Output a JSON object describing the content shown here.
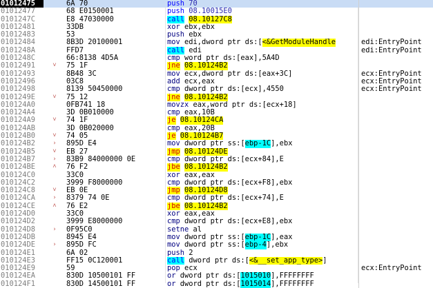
{
  "listing": {
    "rows": [
      {
        "addr": "01012475",
        "arrow": "",
        "bytes": "6A 70",
        "disasm": [
          {
            "t": "push",
            "c": "m-push"
          },
          {
            "t": " 70",
            "c": "op-num"
          }
        ],
        "comment": "",
        "selected": true
      },
      {
        "addr": "01012477",
        "arrow": "",
        "bytes": "68 E0150001",
        "disasm": [
          {
            "t": "push",
            "c": "m-push"
          },
          {
            "t": " 08.10015E0",
            "c": "op-num"
          }
        ],
        "comment": ""
      },
      {
        "addr": "0101247C",
        "arrow": "",
        "bytes": "E8 47030000",
        "disasm": [
          {
            "t": "call",
            "c": "m-call"
          },
          {
            "t": " ",
            "c": "op-plain"
          },
          {
            "t": "08.10127C8",
            "c": "op-sym"
          }
        ],
        "comment": ""
      },
      {
        "addr": "01012481",
        "arrow": "",
        "bytes": "33DB",
        "disasm": [
          {
            "t": "xor",
            "c": "m-plain"
          },
          {
            "t": " ebx,ebx",
            "c": "op-plain"
          }
        ],
        "comment": ""
      },
      {
        "addr": "01012483",
        "arrow": "",
        "bytes": "53",
        "disasm": [
          {
            "t": "push",
            "c": "m-plain"
          },
          {
            "t": " ebx",
            "c": "op-plain"
          }
        ],
        "comment": ""
      },
      {
        "addr": "01012484",
        "arrow": "",
        "bytes": "8B3D 20100001",
        "disasm": [
          {
            "t": "mov",
            "c": "m-plain"
          },
          {
            "t": " edi,dword ptr ds:[",
            "c": "op-plain"
          },
          {
            "t": "<&GetModuleHandle",
            "c": "op-sym"
          },
          {
            "t": "",
            "c": "op-plain"
          }
        ],
        "comment": "edi:EntryPoint"
      },
      {
        "addr": "0101248A",
        "arrow": "",
        "bytes": "FFD7",
        "disasm": [
          {
            "t": "call",
            "c": "m-call"
          },
          {
            "t": " edi",
            "c": "op-plain"
          }
        ],
        "comment": "edi:EntryPoint"
      },
      {
        "addr": "0101248C",
        "arrow": "",
        "bytes": "66:8138 4D5A",
        "disasm": [
          {
            "t": "cmp",
            "c": "m-plain"
          },
          {
            "t": " word ptr ds:[eax],5A4D",
            "c": "op-plain"
          }
        ],
        "comment": ""
      },
      {
        "addr": "01012491",
        "arrow": "v",
        "bytes": "75 1F",
        "disasm": [
          {
            "t": "jne",
            "c": "m-jcc"
          },
          {
            "t": " ",
            "c": "op-plain"
          },
          {
            "t": "08.10124B2",
            "c": "op-sym"
          }
        ],
        "comment": ""
      },
      {
        "addr": "01012493",
        "arrow": "",
        "bytes": "8B48 3C",
        "disasm": [
          {
            "t": "mov",
            "c": "m-plain"
          },
          {
            "t": " ecx,dword ptr ds:[eax+3C]",
            "c": "op-plain"
          }
        ],
        "comment": "ecx:EntryPoint"
      },
      {
        "addr": "01012496",
        "arrow": "",
        "bytes": "03C8",
        "disasm": [
          {
            "t": "add",
            "c": "m-plain"
          },
          {
            "t": " ecx,eax",
            "c": "op-plain"
          }
        ],
        "comment": "ecx:EntryPoint"
      },
      {
        "addr": "01012498",
        "arrow": "",
        "bytes": "8139 50450000",
        "disasm": [
          {
            "t": "cmp",
            "c": "m-plain"
          },
          {
            "t": " dword ptr ds:[ecx],4550",
            "c": "op-plain"
          }
        ],
        "comment": "ecx:EntryPoint"
      },
      {
        "addr": "0101249E",
        "arrow": "v",
        "bytes": "75 12",
        "disasm": [
          {
            "t": "jne",
            "c": "m-jcc"
          },
          {
            "t": " ",
            "c": "op-plain"
          },
          {
            "t": "08.10124B2",
            "c": "op-sym"
          }
        ],
        "comment": ""
      },
      {
        "addr": "010124A0",
        "arrow": "",
        "bytes": "0FB741 18",
        "disasm": [
          {
            "t": "movzx",
            "c": "m-plain"
          },
          {
            "t": " eax,word ptr ds:[ecx+18]",
            "c": "op-plain"
          }
        ],
        "comment": ""
      },
      {
        "addr": "010124A4",
        "arrow": "",
        "bytes": "3D 0B010000",
        "disasm": [
          {
            "t": "cmp",
            "c": "m-plain"
          },
          {
            "t": " eax,10B",
            "c": "op-plain"
          }
        ],
        "comment": ""
      },
      {
        "addr": "010124A9",
        "arrow": "v",
        "bytes": "74 1F",
        "disasm": [
          {
            "t": "je",
            "c": "m-jcc"
          },
          {
            "t": " ",
            "c": "op-plain"
          },
          {
            "t": "08.10124CA",
            "c": "op-sym"
          }
        ],
        "comment": ""
      },
      {
        "addr": "010124AB",
        "arrow": "",
        "bytes": "3D 0B020000",
        "disasm": [
          {
            "t": "cmp",
            "c": "m-plain"
          },
          {
            "t": " eax,20B",
            "c": "op-plain"
          }
        ],
        "comment": ""
      },
      {
        "addr": "010124B0",
        "arrow": "v",
        "bytes": "74 05",
        "disasm": [
          {
            "t": "je",
            "c": "m-jcc"
          },
          {
            "t": " ",
            "c": "op-plain"
          },
          {
            "t": "08.10124B7",
            "c": "op-sym"
          }
        ],
        "comment": ""
      },
      {
        "addr": "010124B2",
        "arrow": ">",
        "bytes": "895D E4",
        "disasm": [
          {
            "t": "mov",
            "c": "m-plain"
          },
          {
            "t": " dword ptr ss:[",
            "c": "op-plain"
          },
          {
            "t": "ebp-1C",
            "c": "hl-reg"
          },
          {
            "t": "],ebx",
            "c": "op-plain"
          }
        ],
        "comment": ""
      },
      {
        "addr": "010124B5",
        "arrow": "v",
        "bytes": "EB 27",
        "disasm": [
          {
            "t": "jmp",
            "c": "m-jcc"
          },
          {
            "t": " ",
            "c": "op-plain"
          },
          {
            "t": "08.10124DE",
            "c": "op-sym"
          }
        ],
        "comment": ""
      },
      {
        "addr": "010124B7",
        "arrow": ">",
        "bytes": "83B9 84000000 0E",
        "disasm": [
          {
            "t": "cmp",
            "c": "m-plain"
          },
          {
            "t": " dword ptr ds:[ecx+84],E",
            "c": "op-plain"
          }
        ],
        "comment": ""
      },
      {
        "addr": "010124BE",
        "arrow": "^",
        "bytes": "76 F2",
        "disasm": [
          {
            "t": "jbe",
            "c": "m-jcc"
          },
          {
            "t": " ",
            "c": "op-plain"
          },
          {
            "t": "08.10124B2",
            "c": "op-sym"
          }
        ],
        "comment": ""
      },
      {
        "addr": "010124C0",
        "arrow": "",
        "bytes": "33C0",
        "disasm": [
          {
            "t": "xor",
            "c": "m-plain"
          },
          {
            "t": " eax,eax",
            "c": "op-plain"
          }
        ],
        "comment": ""
      },
      {
        "addr": "010124C2",
        "arrow": "",
        "bytes": "3999 F8000000",
        "disasm": [
          {
            "t": "cmp",
            "c": "m-plain"
          },
          {
            "t": " dword ptr ds:[ecx+F8],ebx",
            "c": "op-plain"
          }
        ],
        "comment": ""
      },
      {
        "addr": "010124C8",
        "arrow": "v",
        "bytes": "EB 0E",
        "disasm": [
          {
            "t": "jmp",
            "c": "m-jcc"
          },
          {
            "t": " ",
            "c": "op-plain"
          },
          {
            "t": "08.10124D8",
            "c": "op-sym"
          }
        ],
        "comment": ""
      },
      {
        "addr": "010124CA",
        "arrow": ">",
        "bytes": "8379 74 0E",
        "disasm": [
          {
            "t": "cmp",
            "c": "m-plain"
          },
          {
            "t": " dword ptr ds:[ecx+74],E",
            "c": "op-plain"
          }
        ],
        "comment": ""
      },
      {
        "addr": "010124CE",
        "arrow": "^",
        "bytes": "76 E2",
        "disasm": [
          {
            "t": "jbe",
            "c": "m-jcc"
          },
          {
            "t": " ",
            "c": "op-plain"
          },
          {
            "t": "08.10124B2",
            "c": "op-sym"
          }
        ],
        "comment": ""
      },
      {
        "addr": "010124D0",
        "arrow": "",
        "bytes": "33C0",
        "disasm": [
          {
            "t": "xor",
            "c": "m-plain"
          },
          {
            "t": " eax,eax",
            "c": "op-plain"
          }
        ],
        "comment": ""
      },
      {
        "addr": "010124D2",
        "arrow": "",
        "bytes": "3999 E8000000",
        "disasm": [
          {
            "t": "cmp",
            "c": "m-plain"
          },
          {
            "t": " dword ptr ds:[ecx+E8],ebx",
            "c": "op-plain"
          }
        ],
        "comment": ""
      },
      {
        "addr": "010124D8",
        "arrow": ">",
        "bytes": "0F95C0",
        "disasm": [
          {
            "t": "setne",
            "c": "m-plain"
          },
          {
            "t": " al",
            "c": "op-plain"
          }
        ],
        "comment": ""
      },
      {
        "addr": "010124DB",
        "arrow": "",
        "bytes": "8945 E4",
        "disasm": [
          {
            "t": "mov",
            "c": "m-plain"
          },
          {
            "t": " dword ptr ss:[",
            "c": "op-plain"
          },
          {
            "t": "ebp-1C",
            "c": "hl-reg"
          },
          {
            "t": "],eax",
            "c": "op-plain"
          }
        ],
        "comment": ""
      },
      {
        "addr": "010124DE",
        "arrow": ">",
        "bytes": "895D FC",
        "disasm": [
          {
            "t": "mov",
            "c": "m-plain"
          },
          {
            "t": " dword ptr ss:[",
            "c": "op-plain"
          },
          {
            "t": "ebp-4",
            "c": "hl-reg"
          },
          {
            "t": "],ebx",
            "c": "op-plain"
          }
        ],
        "comment": ""
      },
      {
        "addr": "010124E1",
        "arrow": "",
        "bytes": "6A 02",
        "disasm": [
          {
            "t": "push",
            "c": "m-plain"
          },
          {
            "t": " 2",
            "c": "op-plain"
          }
        ],
        "comment": ""
      },
      {
        "addr": "010124E3",
        "arrow": "",
        "bytes": "FF15 0C120001",
        "disasm": [
          {
            "t": "call",
            "c": "m-call"
          },
          {
            "t": " dword ptr ds:[",
            "c": "op-plain"
          },
          {
            "t": "<&__set_app_type>",
            "c": "op-sym"
          },
          {
            "t": "]",
            "c": "op-plain"
          }
        ],
        "comment": ""
      },
      {
        "addr": "010124E9",
        "arrow": "",
        "bytes": "59",
        "disasm": [
          {
            "t": "pop",
            "c": "m-plain"
          },
          {
            "t": " ecx",
            "c": "op-plain"
          }
        ],
        "comment": "ecx:EntryPoint"
      },
      {
        "addr": "010124EA",
        "arrow": "",
        "bytes": "830D 10500101 FF",
        "disasm": [
          {
            "t": "or",
            "c": "m-plain"
          },
          {
            "t": " dword ptr ds:[",
            "c": "op-plain"
          },
          {
            "t": "1015010",
            "c": "op-addr"
          },
          {
            "t": "],FFFFFFFF",
            "c": "op-plain"
          }
        ],
        "comment": ""
      },
      {
        "addr": "010124F1",
        "arrow": "",
        "bytes": "830D 14500101 FF",
        "disasm": [
          {
            "t": "or",
            "c": "m-plain"
          },
          {
            "t": " dword ptr ds:[",
            "c": "op-plain"
          },
          {
            "t": "1015014",
            "c": "op-addr"
          },
          {
            "t": "],FFFFFFFF",
            "c": "op-plain"
          }
        ],
        "comment": ""
      }
    ]
  }
}
